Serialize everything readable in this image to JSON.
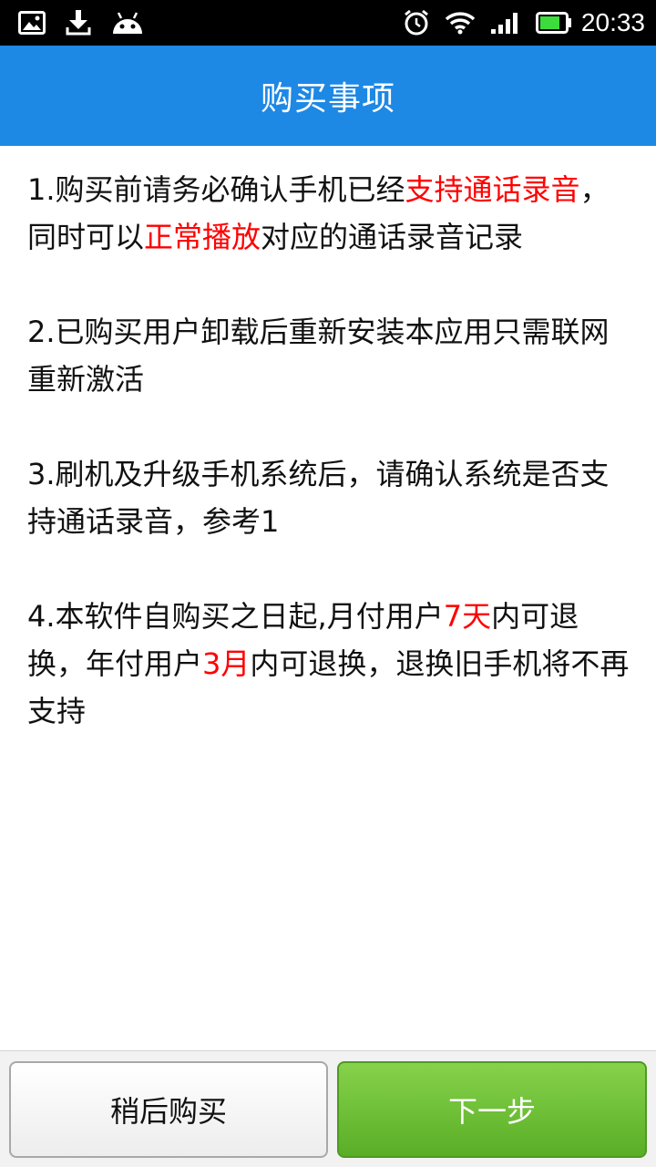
{
  "status_bar": {
    "time": "20:33",
    "icons_left": [
      "image-icon",
      "download-icon",
      "android-icon"
    ],
    "icons_right": [
      "alarm-icon",
      "wifi-icon",
      "signal-icon",
      "battery-icon"
    ]
  },
  "header": {
    "title": "购买事项"
  },
  "notices": [
    {
      "segments": [
        {
          "text": "1.购买前请务必确认手机已经"
        },
        {
          "text": "支持通话录音",
          "highlight": true
        },
        {
          "text": "，同时可以"
        },
        {
          "text": "正常播放",
          "highlight": true
        },
        {
          "text": "对应的通话录音记录"
        }
      ]
    },
    {
      "segments": [
        {
          "text": "2.已购买用户卸载后重新安装本应用只需联网重新激活"
        }
      ]
    },
    {
      "segments": [
        {
          "text": "3.刷机及升级手机系统后，请确认系统是否支持通话录音，参考1"
        }
      ]
    },
    {
      "segments": [
        {
          "text": "4.本软件自购买之日起,月付用户"
        },
        {
          "text": "7天",
          "highlight": true
        },
        {
          "text": "内可退换，年付用户"
        },
        {
          "text": "3月",
          "highlight": true
        },
        {
          "text": "内可退换，退换旧手机将不再支持"
        }
      ]
    }
  ],
  "footer": {
    "later_label": "稍后购买",
    "next_label": "下一步"
  },
  "colors": {
    "title_bar": "#1e88e5",
    "highlight": "#ff0000",
    "next_button": "#6cc036"
  }
}
